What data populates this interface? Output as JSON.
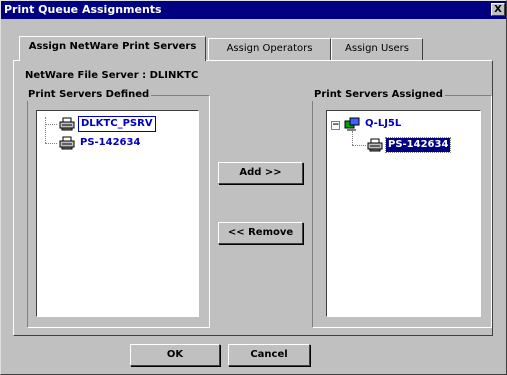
{
  "window": {
    "title": "Print Queue Assignments",
    "close_glyph": "X"
  },
  "tabs": [
    {
      "label": "Assign NetWare Print Servers",
      "active": true
    },
    {
      "label": "Assign Operators",
      "active": false
    },
    {
      "label": "Assign Users",
      "active": false
    }
  ],
  "file_server_label": "NetWare File Server :  DLINKTC",
  "defined": {
    "title": "Print Servers Defined",
    "items": [
      {
        "label": "DLKTC_PSRV",
        "icon": "printer-icon",
        "state": "focused"
      },
      {
        "label": "PS-142634",
        "icon": "printer-icon",
        "state": "normal"
      }
    ]
  },
  "assigned": {
    "title": "Print Servers Assigned",
    "queue": {
      "label": "Q-LJ5L",
      "icon": "print-queue-icon",
      "expander": "−"
    },
    "items": [
      {
        "label": "PS-142634",
        "icon": "printer-icon",
        "state": "selected"
      }
    ]
  },
  "buttons": {
    "add": "Add >>",
    "remove": "<< Remove",
    "ok": "OK",
    "cancel": "Cancel"
  },
  "colors": {
    "title_bar": "#000080",
    "face": "#c0c0c0",
    "link_text": "#0000c0",
    "selection": "#000080"
  }
}
